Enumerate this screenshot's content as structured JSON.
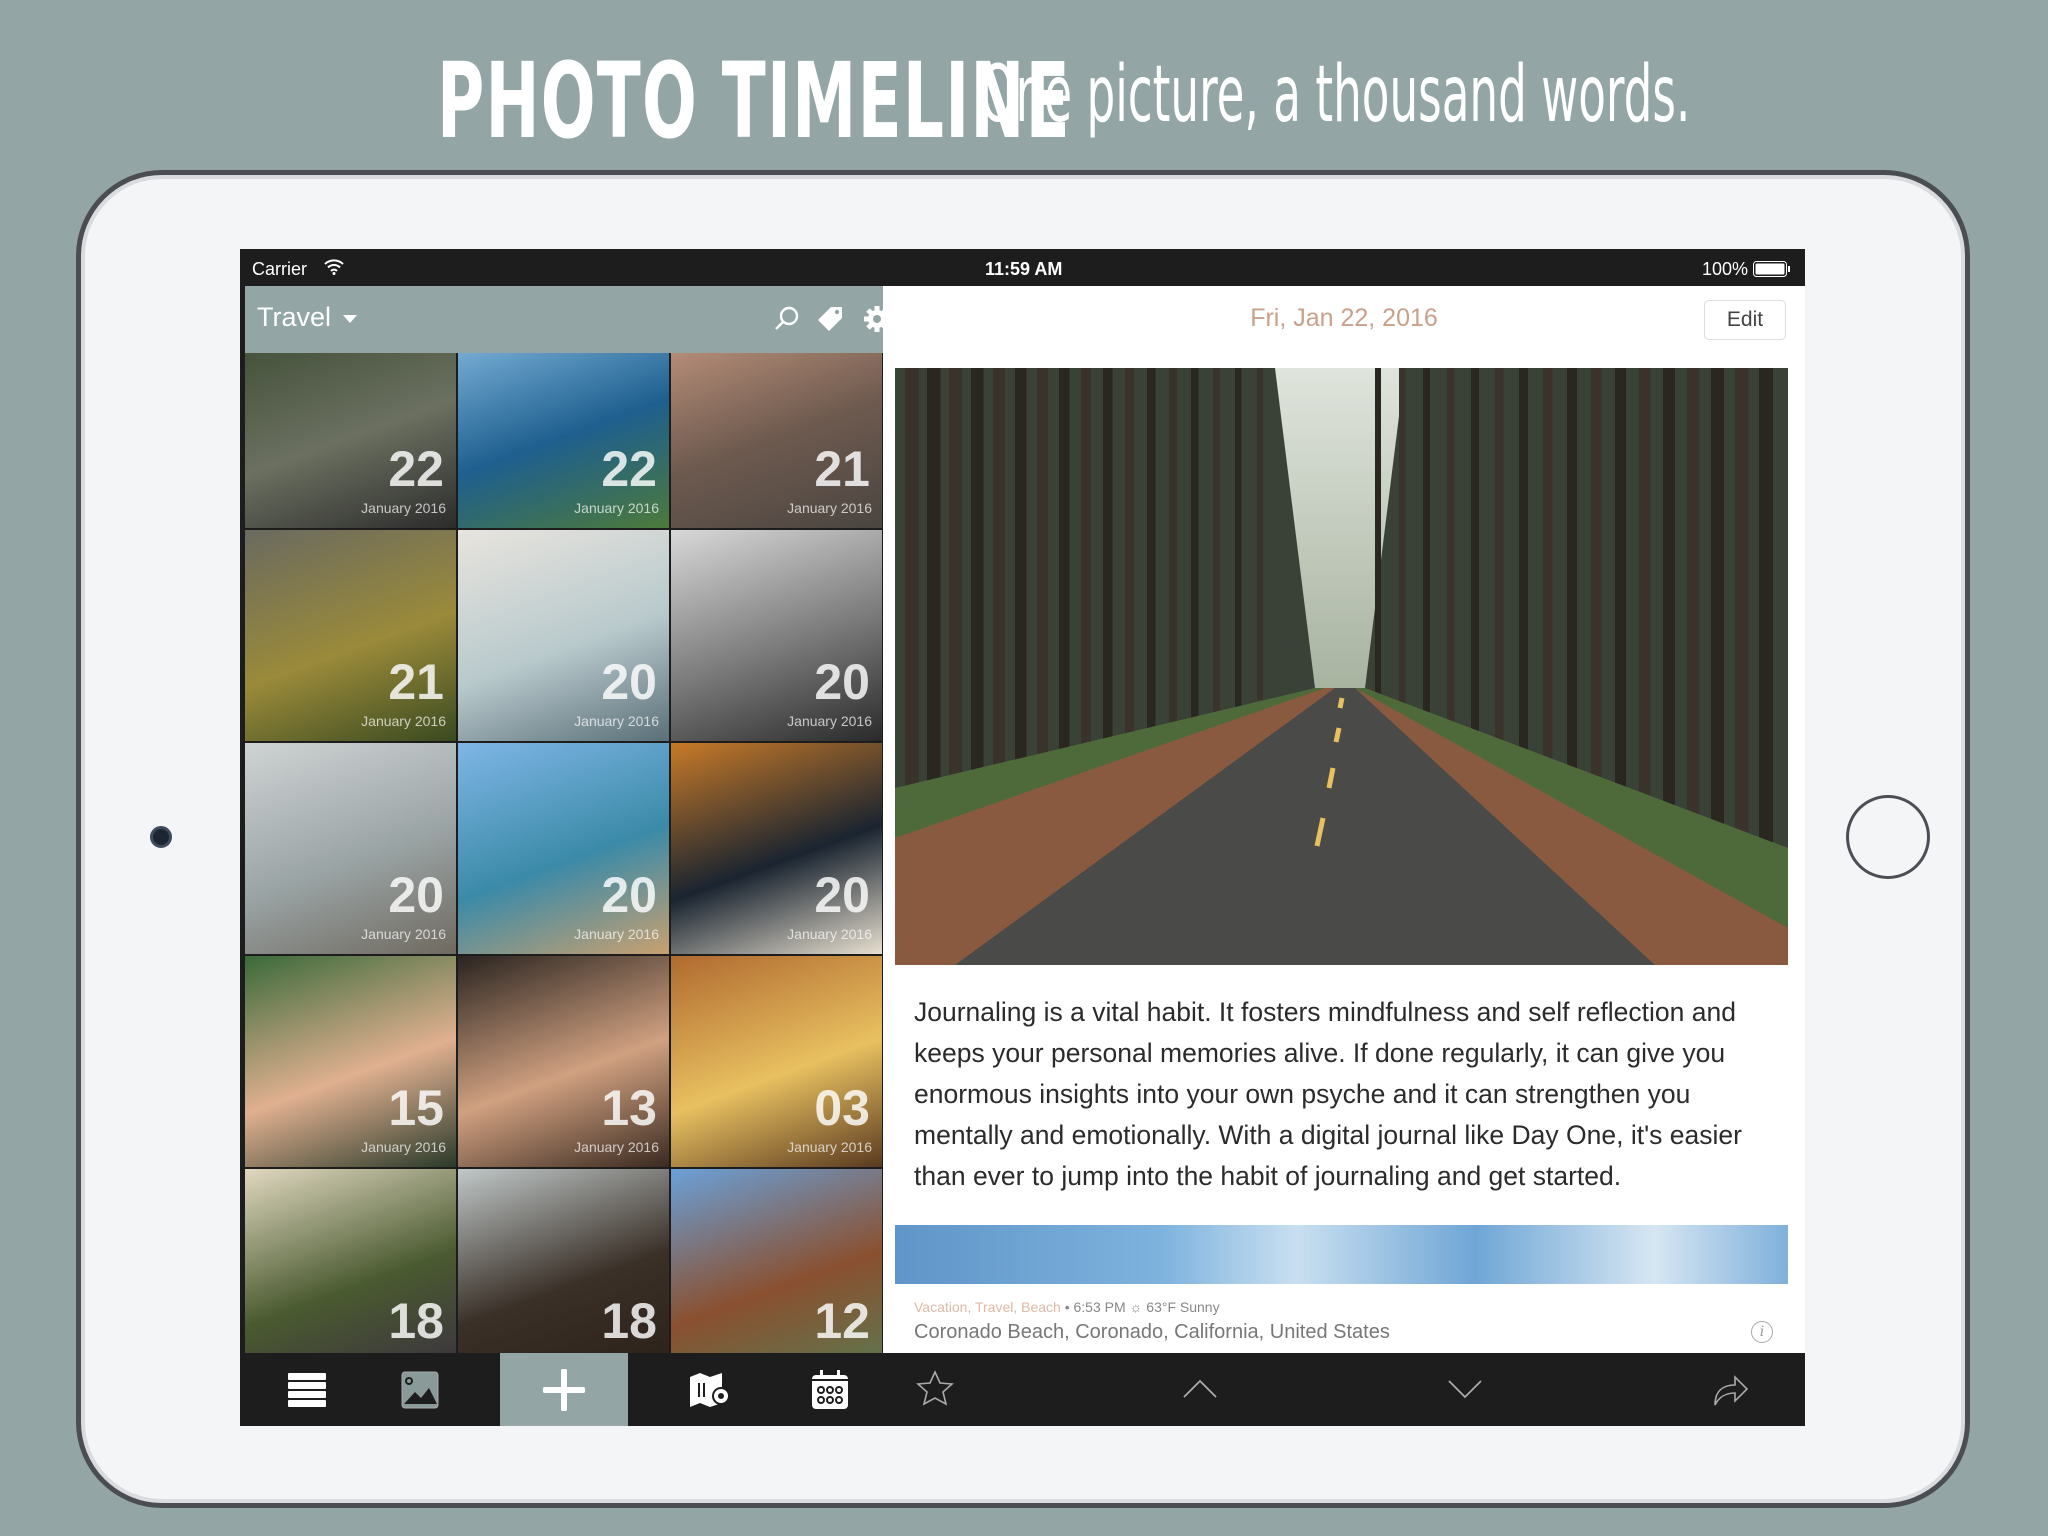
{
  "headline": {
    "title": "PHOTO TIMELINE",
    "tagline": "One picture, a thousand words."
  },
  "status_bar": {
    "carrier": "Carrier",
    "time": "11:59 AM",
    "battery": "100%"
  },
  "left_panel": {
    "journal_name": "Travel",
    "header_icons": [
      "search-icon",
      "tag-icon",
      "gear-icon"
    ],
    "tiles": [
      {
        "day": "22",
        "month": "January 2016",
        "palette": [
          "#3b4a32",
          "#6b7060",
          "#2c2c2c"
        ]
      },
      {
        "day": "22",
        "month": "January 2016",
        "palette": [
          "#8cc0e6",
          "#1e5f8f",
          "#4d7a3a"
        ]
      },
      {
        "day": "21",
        "month": "January 2016",
        "palette": [
          "#c89a82",
          "#6e5a4f",
          "#4a4540"
        ]
      },
      {
        "day": "21",
        "month": "January 2016",
        "palette": [
          "#6a6a60",
          "#9a8a3a",
          "#3a4a20"
        ]
      },
      {
        "day": "20",
        "month": "January 2016",
        "palette": [
          "#e8e4de",
          "#b8c9cc",
          "#5a6f78"
        ]
      },
      {
        "day": "20",
        "month": "January 2016",
        "palette": [
          "#d8d8d8",
          "#7a7a7a",
          "#2a2a2a"
        ]
      },
      {
        "day": "20",
        "month": "January 2016",
        "palette": [
          "#cfd3d4",
          "#9aa3a4",
          "#6f6a60"
        ]
      },
      {
        "day": "20",
        "month": "January 2016",
        "palette": [
          "#7fb6e6",
          "#3b8aa8",
          "#c8a070"
        ]
      },
      {
        "day": "20",
        "month": "January 2016",
        "palette": [
          "#c87a28",
          "#1a2430",
          "#e8e0d0"
        ]
      },
      {
        "day": "15",
        "month": "January 2016",
        "palette": [
          "#3a6a3a",
          "#e0b090",
          "#2a3a2a"
        ]
      },
      {
        "day": "13",
        "month": "January 2016",
        "palette": [
          "#2a2420",
          "#d0a080",
          "#3a2a20"
        ]
      },
      {
        "day": "03",
        "month": "January 2016",
        "palette": [
          "#b06a30",
          "#e8c060",
          "#5a3a20"
        ]
      },
      {
        "day": "18",
        "month": "",
        "palette": [
          "#e0d8c0",
          "#4a5a30",
          "#3a3040"
        ]
      },
      {
        "day": "18",
        "month": "",
        "palette": [
          "#c0c8c8",
          "#3a3028",
          "#2a2018"
        ]
      },
      {
        "day": "12",
        "month": "",
        "palette": [
          "#6aa0d8",
          "#8a5030",
          "#5a7a50"
        ]
      }
    ],
    "tabs": [
      "list-icon",
      "photos-icon",
      "add-icon",
      "map-icon",
      "calendar-icon"
    ],
    "active_tab": "add-icon",
    "accent": "#93a6a5"
  },
  "entry": {
    "date": "Fri, Jan 22, 2016",
    "edit_label": "Edit",
    "text": "Journaling is a vital habit. It fosters mindfulness and self reflection and keeps your personal memories alive. If done regularly, it can give you enormous insights into your own psyche and it can strengthen you mentally and emotionally. With a digital journal like Day One, it's easier than ever to jump into the habit of journaling and get started.",
    "tags": "Vacation, Travel, Beach",
    "time": "• 6:53 PM",
    "weather": "63°F Sunny",
    "location": "Coronado Beach, Coronado, California, United States",
    "date_color": "#c9a08a",
    "toolbar": [
      "star-icon",
      "chevron-up-icon",
      "chevron-down-icon",
      "share-icon"
    ]
  }
}
